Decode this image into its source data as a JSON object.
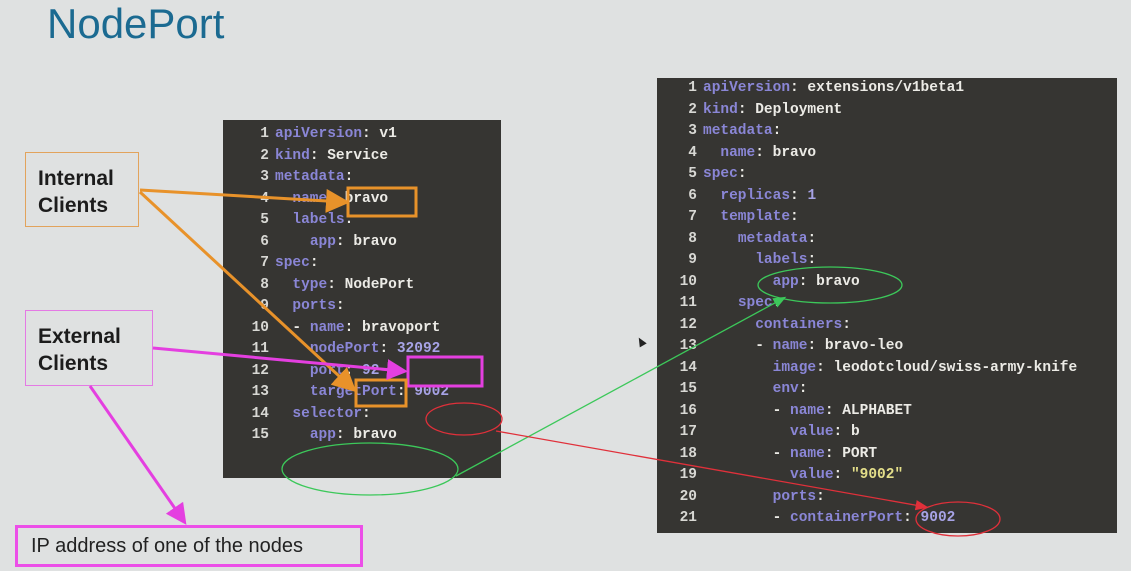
{
  "title": "NodePort",
  "labels": {
    "internal_line1": "Internal",
    "internal_line2": "Clients",
    "external_line1": "External",
    "external_line2": "Clients",
    "ip_address": "IP address of one of the nodes"
  },
  "service_yaml": [
    {
      "n": "1",
      "indent": "",
      "key": "apiVersion",
      "sep": ": ",
      "val": "v1"
    },
    {
      "n": "2",
      "indent": "",
      "key": "kind",
      "sep": ": ",
      "val": "Service"
    },
    {
      "n": "3",
      "indent": "",
      "key": "metadata",
      "sep": ":",
      "val": ""
    },
    {
      "n": "4",
      "indent": "  ",
      "key": "name",
      "sep": ": ",
      "val": "bravo"
    },
    {
      "n": "5",
      "indent": "  ",
      "key": "labels",
      "sep": ":",
      "val": ""
    },
    {
      "n": "6",
      "indent": "    ",
      "key": "app",
      "sep": ": ",
      "val": "bravo"
    },
    {
      "n": "7",
      "indent": "",
      "key": "spec",
      "sep": ":",
      "val": ""
    },
    {
      "n": "8",
      "indent": "  ",
      "key": "type",
      "sep": ": ",
      "val": "NodePort"
    },
    {
      "n": "9",
      "indent": "  ",
      "key": "ports",
      "sep": ":",
      "val": ""
    },
    {
      "n": "10",
      "indent": "  - ",
      "key": "name",
      "sep": ": ",
      "val": "bravoport"
    },
    {
      "n": "11",
      "indent": "    ",
      "key": "nodePort",
      "sep": ": ",
      "val": "32092",
      "num": true
    },
    {
      "n": "12",
      "indent": "    ",
      "key": "port",
      "sep": ": ",
      "val": "92",
      "num": true
    },
    {
      "n": "13",
      "indent": "    ",
      "key": "targetPort",
      "sep": ": ",
      "val": "9002",
      "num": true
    },
    {
      "n": "14",
      "indent": "  ",
      "key": "selector",
      "sep": ":",
      "val": ""
    },
    {
      "n": "15",
      "indent": "    ",
      "key": "app",
      "sep": ": ",
      "val": "bravo"
    }
  ],
  "deployment_yaml": [
    {
      "n": "1",
      "indent": "",
      "key": "apiVersion",
      "sep": ": ",
      "val": "extensions/v1beta1"
    },
    {
      "n": "2",
      "indent": "",
      "key": "kind",
      "sep": ": ",
      "val": "Deployment"
    },
    {
      "n": "3",
      "indent": "",
      "key": "metadata",
      "sep": ":",
      "val": ""
    },
    {
      "n": "4",
      "indent": "  ",
      "key": "name",
      "sep": ": ",
      "val": "bravo"
    },
    {
      "n": "5",
      "indent": "",
      "key": "spec",
      "sep": ":",
      "val": ""
    },
    {
      "n": "6",
      "indent": "  ",
      "key": "replicas",
      "sep": ": ",
      "val": "1",
      "num": true
    },
    {
      "n": "7",
      "indent": "  ",
      "key": "template",
      "sep": ":",
      "val": ""
    },
    {
      "n": "8",
      "indent": "    ",
      "key": "metadata",
      "sep": ":",
      "val": ""
    },
    {
      "n": "9",
      "indent": "      ",
      "key": "labels",
      "sep": ":",
      "val": ""
    },
    {
      "n": "10",
      "indent": "        ",
      "key": "app",
      "sep": ": ",
      "val": "bravo"
    },
    {
      "n": "11",
      "indent": "    ",
      "key": "spec",
      "sep": ":",
      "val": ""
    },
    {
      "n": "12",
      "indent": "      ",
      "key": "containers",
      "sep": ":",
      "val": ""
    },
    {
      "n": "13",
      "indent": "      - ",
      "key": "name",
      "sep": ": ",
      "val": "bravo-leo"
    },
    {
      "n": "14",
      "indent": "        ",
      "key": "image",
      "sep": ": ",
      "val": "leodotcloud/swiss-army-knife"
    },
    {
      "n": "15",
      "indent": "        ",
      "key": "env",
      "sep": ":",
      "val": ""
    },
    {
      "n": "16",
      "indent": "        - ",
      "key": "name",
      "sep": ": ",
      "val": "ALPHABET"
    },
    {
      "n": "17",
      "indent": "          ",
      "key": "value",
      "sep": ": ",
      "val": "b"
    },
    {
      "n": "18",
      "indent": "        - ",
      "key": "name",
      "sep": ": ",
      "val": "PORT"
    },
    {
      "n": "19",
      "indent": "          ",
      "key": "value",
      "sep": ": ",
      "val": "\"9002\"",
      "str": true
    },
    {
      "n": "20",
      "indent": "        ",
      "key": "ports",
      "sep": ":",
      "val": ""
    },
    {
      "n": "21",
      "indent": "        - ",
      "key": "containerPort",
      "sep": ": ",
      "val": "9002",
      "num": true
    }
  ],
  "colors": {
    "title": "#1b6a91",
    "internal_arrow": "#e8922a",
    "external_arrow": "#e43fe0",
    "selector_link": "#3cc85a",
    "port_link": "#e0303a"
  }
}
